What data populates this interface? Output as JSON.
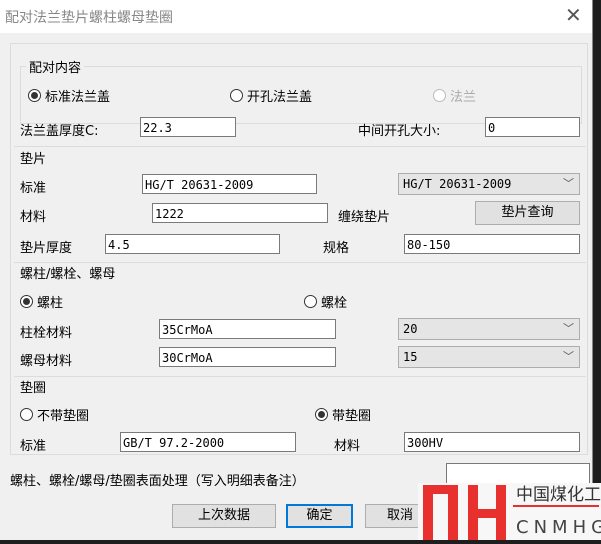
{
  "title": "配对法兰垫片螺柱螺母垫圈",
  "pairing": {
    "label": "配对内容",
    "options": [
      "标准法兰盖",
      "开孔法兰盖",
      "法兰"
    ],
    "selected": 0
  },
  "flange": {
    "thickness_label": "法兰盖厚度C:",
    "thickness": "22.3",
    "hole_label": "中间开孔大小:",
    "hole": "0"
  },
  "gasket": {
    "label": "垫片",
    "standard_label": "标准",
    "standard": "HG/T 20631-2009",
    "standard_combo": "HG/T 20631-2009",
    "material_label": "材料",
    "material": "1222",
    "type_label": "缠绕垫片",
    "query_button": "垫片查询",
    "thickness_label": "垫片厚度",
    "thickness": "4.5",
    "spec_label": "规格",
    "spec": "80-150"
  },
  "bolt": {
    "label": "螺柱/螺栓、螺母",
    "options": [
      "螺柱",
      "螺栓"
    ],
    "selected": 0,
    "stud_material_label": "柱栓材料",
    "stud_material": "35CrMoA",
    "stud_combo": "20",
    "nut_material_label": "螺母材料",
    "nut_material": "30CrMoA",
    "nut_combo": "15"
  },
  "washer": {
    "label": "垫圈",
    "options": [
      "不带垫圈",
      "带垫圈"
    ],
    "selected": 1,
    "standard_label": "标准",
    "standard": "GB/T 97.2-2000",
    "material_label": "材料",
    "material": "300HV"
  },
  "surface": {
    "label": "螺柱、螺栓/螺母/垫圈表面处理（写入明细表备注）",
    "value": ""
  },
  "buttons": {
    "last": "上次数据",
    "ok": "确定",
    "cancel": "取消"
  },
  "watermark": {
    "letters": "MH",
    "cn": "中国煤化工",
    "en": "CNMHG"
  }
}
